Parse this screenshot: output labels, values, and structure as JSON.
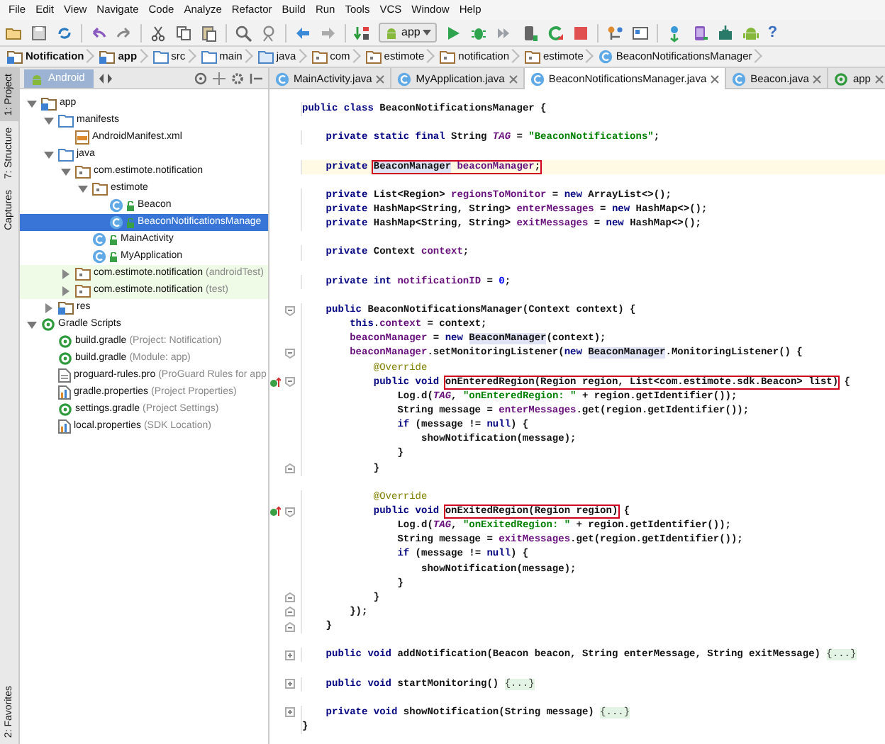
{
  "menu": [
    "File",
    "Edit",
    "View",
    "Navigate",
    "Code",
    "Analyze",
    "Refactor",
    "Build",
    "Run",
    "Tools",
    "VCS",
    "Window",
    "Help"
  ],
  "toolbar": {
    "run_config": "app",
    "help": "?"
  },
  "breadcrumbs": [
    {
      "label": "Notification",
      "kind": "project"
    },
    {
      "label": "app",
      "kind": "module"
    },
    {
      "label": "src",
      "kind": "folder"
    },
    {
      "label": "main",
      "kind": "folder"
    },
    {
      "label": "java",
      "kind": "source"
    },
    {
      "label": "com",
      "kind": "package"
    },
    {
      "label": "estimote",
      "kind": "package"
    },
    {
      "label": "notification",
      "kind": "package"
    },
    {
      "label": "estimote",
      "kind": "package"
    },
    {
      "label": "BeaconNotificationsManager",
      "kind": "class"
    }
  ],
  "tool_stripe": {
    "top": [
      {
        "label": "1: Project",
        "selected": true
      },
      {
        "label": "7: Structure",
        "selected": false
      },
      {
        "label": "Captures",
        "selected": false
      }
    ],
    "bottom": [
      {
        "label": "2: Favorites",
        "selected": false
      }
    ]
  },
  "project": {
    "view": "Android",
    "tree": [
      {
        "label": "app",
        "kind": "module",
        "expanded": true,
        "selected": false,
        "test": false,
        "children": [
          {
            "label": "manifests",
            "kind": "folder",
            "expanded": true,
            "selected": false,
            "test": false,
            "children": [
              {
                "label": "AndroidManifest.xml",
                "kind": "xml",
                "selected": false,
                "test": false
              }
            ]
          },
          {
            "label": "java",
            "kind": "folder",
            "expanded": true,
            "selected": false,
            "test": false,
            "children": [
              {
                "label": "com.estimote.notification",
                "kind": "package",
                "expanded": true,
                "selected": false,
                "test": false,
                "children": [
                  {
                    "label": "estimote",
                    "kind": "package",
                    "expanded": true,
                    "selected": false,
                    "test": false,
                    "children": [
                      {
                        "label": "Beacon",
                        "kind": "class",
                        "selected": false,
                        "test": false
                      },
                      {
                        "label": "BeaconNotificationsManage",
                        "kind": "class",
                        "selected": true,
                        "test": false
                      }
                    ]
                  },
                  {
                    "label": "MainActivity",
                    "kind": "class",
                    "selected": false,
                    "test": false
                  },
                  {
                    "label": "MyApplication",
                    "kind": "class",
                    "selected": false,
                    "test": false
                  }
                ]
              },
              {
                "label": "com.estimote.notification",
                "hint": "(androidTest)",
                "kind": "package",
                "expanded": false,
                "selected": false,
                "test": true
              },
              {
                "label": "com.estimote.notification",
                "hint": "(test)",
                "kind": "package",
                "expanded": false,
                "selected": false,
                "test": true
              }
            ]
          },
          {
            "label": "res",
            "kind": "module",
            "expanded": false,
            "selected": false,
            "test": false
          }
        ]
      },
      {
        "label": "Gradle Scripts",
        "kind": "gradle",
        "expanded": true,
        "selected": false,
        "test": false,
        "children": [
          {
            "label": "build.gradle",
            "hint": "(Project: Notification)",
            "kind": "gradle",
            "selected": false,
            "test": false
          },
          {
            "label": "build.gradle",
            "hint": "(Module: app)",
            "kind": "gradle",
            "selected": false,
            "test": false
          },
          {
            "label": "proguard-rules.pro",
            "hint": "(ProGuard Rules for app",
            "kind": "file",
            "selected": false,
            "test": false
          },
          {
            "label": "gradle.properties",
            "hint": "(Project Properties)",
            "kind": "properties",
            "selected": false,
            "test": false
          },
          {
            "label": "settings.gradle",
            "hint": "(Project Settings)",
            "kind": "gradle",
            "selected": false,
            "test": false
          },
          {
            "label": "local.properties",
            "hint": "(SDK Location)",
            "kind": "properties",
            "selected": false,
            "test": false
          }
        ]
      }
    ]
  },
  "editor_tabs": [
    {
      "label": "MainActivity.java",
      "kind": "class",
      "selected": false
    },
    {
      "label": "MyApplication.java",
      "kind": "class",
      "selected": false
    },
    {
      "label": "BeaconNotificationsManager.java",
      "kind": "class",
      "selected": true
    },
    {
      "label": "Beacon.java",
      "kind": "class",
      "selected": false
    },
    {
      "label": "app",
      "kind": "gradle",
      "selected": false
    }
  ],
  "editor": {
    "lines": [
      {
        "current": false,
        "tokens": [
          {
            "kind": "keyword",
            "text": "public class"
          },
          {
            "kind": "plain",
            "text": " BeaconNotificationsManager {"
          }
        ],
        "children": [
          {
            "current": false,
            "gap_before": true,
            "tokens": [
              {
                "kind": "keyword",
                "text": "private static final"
              },
              {
                "kind": "plain",
                "text": " String "
              },
              {
                "kind": "static",
                "text": "TAG"
              },
              {
                "kind": "plain",
                "text": " = "
              },
              {
                "kind": "string",
                "text": "\"BeaconNotifications\""
              },
              {
                "kind": "plain",
                "text": ";"
              }
            ]
          },
          {
            "current": true,
            "gap_before": true,
            "tokens": [
              {
                "kind": "keyword",
                "text": "private "
              },
              {
                "kind": "box",
                "children": [
                  {
                    "kind": "usage",
                    "text": "BeaconManager"
                  },
                  {
                    "kind": "field",
                    "text": " beaconManager"
                  },
                  {
                    "kind": "plain",
                    "text": ";"
                  }
                ]
              }
            ]
          },
          {
            "current": false,
            "gap_before": true,
            "tokens": [
              {
                "kind": "keyword",
                "text": "private"
              },
              {
                "kind": "plain",
                "text": " List<Region> "
              },
              {
                "kind": "field",
                "text": "regionsToMonitor"
              },
              {
                "kind": "plain",
                "text": " = "
              },
              {
                "kind": "keyword",
                "text": "new"
              },
              {
                "kind": "plain",
                "text": " ArrayList<>();"
              }
            ]
          },
          {
            "current": false,
            "tokens": [
              {
                "kind": "keyword",
                "text": "private"
              },
              {
                "kind": "plain",
                "text": " HashMap<String, String> "
              },
              {
                "kind": "field",
                "text": "enterMessages"
              },
              {
                "kind": "plain",
                "text": " = "
              },
              {
                "kind": "keyword",
                "text": "new"
              },
              {
                "kind": "plain",
                "text": " HashMap<>();"
              }
            ]
          },
          {
            "current": false,
            "tokens": [
              {
                "kind": "keyword",
                "text": "private"
              },
              {
                "kind": "plain",
                "text": " HashMap<String, String> "
              },
              {
                "kind": "field",
                "text": "exitMessages"
              },
              {
                "kind": "plain",
                "text": " = "
              },
              {
                "kind": "keyword",
                "text": "new"
              },
              {
                "kind": "plain",
                "text": " HashMap<>();"
              }
            ]
          },
          {
            "current": false,
            "gap_before": true,
            "tokens": [
              {
                "kind": "keyword",
                "text": "private"
              },
              {
                "kind": "plain",
                "text": " Context "
              },
              {
                "kind": "field",
                "text": "context"
              },
              {
                "kind": "plain",
                "text": ";"
              }
            ]
          },
          {
            "current": false,
            "gap_before": true,
            "tokens": [
              {
                "kind": "keyword",
                "text": "private int "
              },
              {
                "kind": "field",
                "text": "notificationID"
              },
              {
                "kind": "plain",
                "text": " = "
              },
              {
                "kind": "number",
                "text": "0"
              },
              {
                "kind": "plain",
                "text": ";"
              }
            ]
          },
          {
            "current": false,
            "gap_before": true,
            "fold_start": true,
            "tokens": [
              {
                "kind": "keyword",
                "text": "public"
              },
              {
                "kind": "plain",
                "text": " BeaconNotificationsManager(Context context) {"
              }
            ],
            "children": [
              {
                "current": false,
                "tokens": [
                  {
                    "kind": "keyword",
                    "text": "this"
                  },
                  {
                    "kind": "plain",
                    "text": "."
                  },
                  {
                    "kind": "field",
                    "text": "context"
                  },
                  {
                    "kind": "plain",
                    "text": " = context;"
                  }
                ]
              },
              {
                "current": false,
                "tokens": [
                  {
                    "kind": "field",
                    "text": "beaconManager"
                  },
                  {
                    "kind": "plain",
                    "text": " = "
                  },
                  {
                    "kind": "keyword",
                    "text": "new "
                  },
                  {
                    "kind": "usage",
                    "text": "BeaconManager"
                  },
                  {
                    "kind": "plain",
                    "text": "(context);"
                  }
                ]
              },
              {
                "current": false,
                "fold_start": true,
                "tokens": [
                  {
                    "kind": "field",
                    "text": "beaconManager"
                  },
                  {
                    "kind": "plain",
                    "text": ".setMonitoringListener("
                  },
                  {
                    "kind": "keyword",
                    "text": "new "
                  },
                  {
                    "kind": "usage",
                    "text": "BeaconManager"
                  },
                  {
                    "kind": "plain",
                    "text": ".MonitoringListener() {"
                  }
                ],
                "children": [
                  {
                    "current": false,
                    "tokens": [
                      {
                        "kind": "annotation",
                        "text": "@Override"
                      }
                    ]
                  },
                  {
                    "current": false,
                    "fold_start": true,
                    "override": true,
                    "tokens": [
                      {
                        "kind": "keyword",
                        "text": "public void "
                      },
                      {
                        "kind": "box",
                        "children": [
                          {
                            "kind": "plain",
                            "text": "onEnteredRegion(Region region, List<com.estimote.sdk.Beacon> list)"
                          }
                        ]
                      },
                      {
                        "kind": "plain",
                        "text": " {"
                      }
                    ],
                    "children": [
                      {
                        "current": false,
                        "tokens": [
                          {
                            "kind": "plain",
                            "text": "Log.d("
                          },
                          {
                            "kind": "static",
                            "text": "TAG"
                          },
                          {
                            "kind": "plain",
                            "text": ", "
                          },
                          {
                            "kind": "string",
                            "text": "\"onEnteredRegion: \""
                          },
                          {
                            "kind": "plain",
                            "text": " + region.getIdentifier());"
                          }
                        ]
                      },
                      {
                        "current": false,
                        "tokens": [
                          {
                            "kind": "plain",
                            "text": "String message = "
                          },
                          {
                            "kind": "field",
                            "text": "enterMessages"
                          },
                          {
                            "kind": "plain",
                            "text": ".get(region.getIdentifier());"
                          }
                        ]
                      },
                      {
                        "current": false,
                        "tokens": [
                          {
                            "kind": "keyword",
                            "text": "if"
                          },
                          {
                            "kind": "plain",
                            "text": " (message != "
                          },
                          {
                            "kind": "keyword",
                            "text": "null"
                          },
                          {
                            "kind": "plain",
                            "text": ") {"
                          }
                        ],
                        "children": [
                          {
                            "current": false,
                            "tokens": [
                              {
                                "kind": "plain",
                                "text": "showNotification(message);"
                              }
                            ]
                          }
                        ]
                      },
                      {
                        "current": false,
                        "tokens": [
                          {
                            "kind": "plain",
                            "text": "}"
                          }
                        ]
                      }
                    ]
                  },
                  {
                    "current": false,
                    "fold_end": true,
                    "tokens": [
                      {
                        "kind": "plain",
                        "text": "}"
                      }
                    ]
                  },
                  {
                    "current": false,
                    "gap_before": true,
                    "tokens": [
                      {
                        "kind": "annotation",
                        "text": "@Override"
                      }
                    ]
                  },
                  {
                    "current": false,
                    "fold_start": true,
                    "override": true,
                    "tokens": [
                      {
                        "kind": "keyword",
                        "text": "public void "
                      },
                      {
                        "kind": "box",
                        "children": [
                          {
                            "kind": "plain",
                            "text": "onExitedRegion(Region region)"
                          }
                        ]
                      },
                      {
                        "kind": "plain",
                        "text": " {"
                      }
                    ],
                    "children": [
                      {
                        "current": false,
                        "tokens": [
                          {
                            "kind": "plain",
                            "text": "Log.d("
                          },
                          {
                            "kind": "static",
                            "text": "TAG"
                          },
                          {
                            "kind": "plain",
                            "text": ", "
                          },
                          {
                            "kind": "string",
                            "text": "\"onExitedRegion: \""
                          },
                          {
                            "kind": "plain",
                            "text": " + region.getIdentifier());"
                          }
                        ]
                      },
                      {
                        "current": false,
                        "tokens": [
                          {
                            "kind": "plain",
                            "text": "String message = "
                          },
                          {
                            "kind": "field",
                            "text": "exitMessages"
                          },
                          {
                            "kind": "plain",
                            "text": ".get(region.getIdentifier());"
                          }
                        ]
                      },
                      {
                        "current": false,
                        "tokens": [
                          {
                            "kind": "keyword",
                            "text": "if"
                          },
                          {
                            "kind": "plain",
                            "text": " (message != "
                          },
                          {
                            "kind": "keyword",
                            "text": "null"
                          },
                          {
                            "kind": "plain",
                            "text": ") {"
                          }
                        ],
                        "children": [
                          {
                            "current": false,
                            "tokens": [
                              {
                                "kind": "plain",
                                "text": "showNotification(message);"
                              }
                            ]
                          }
                        ]
                      },
                      {
                        "current": false,
                        "tokens": [
                          {
                            "kind": "plain",
                            "text": "}"
                          }
                        ]
                      }
                    ]
                  },
                  {
                    "current": false,
                    "fold_end": true,
                    "tokens": [
                      {
                        "kind": "plain",
                        "text": "}"
                      }
                    ]
                  }
                ]
              },
              {
                "current": false,
                "fold_end": true,
                "tokens": [
                  {
                    "kind": "plain",
                    "text": "});"
                  }
                ]
              }
            ]
          },
          {
            "current": false,
            "fold_end": true,
            "tokens": [
              {
                "kind": "plain",
                "text": "}"
              }
            ]
          },
          {
            "current": false,
            "gap_before": true,
            "collapsed": true,
            "tokens": [
              {
                "kind": "keyword",
                "text": "public void"
              },
              {
                "kind": "plain",
                "text": " addNotification(Beacon beacon, String enterMessage, String exitMessage) "
              },
              {
                "kind": "folded",
                "text": "{...}"
              }
            ]
          },
          {
            "current": false,
            "gap_before": true,
            "collapsed": true,
            "tokens": [
              {
                "kind": "keyword",
                "text": "public void"
              },
              {
                "kind": "plain",
                "text": " startMonitoring() "
              },
              {
                "kind": "folded",
                "text": "{...}"
              }
            ]
          },
          {
            "current": false,
            "gap_before": true,
            "collapsed": true,
            "tokens": [
              {
                "kind": "keyword",
                "text": "private void"
              },
              {
                "kind": "plain",
                "text": " showNotification(String message) "
              },
              {
                "kind": "folded",
                "text": "{...}"
              }
            ]
          }
        ]
      },
      {
        "current": false,
        "tokens": [
          {
            "kind": "plain",
            "text": "}"
          }
        ]
      }
    ]
  }
}
